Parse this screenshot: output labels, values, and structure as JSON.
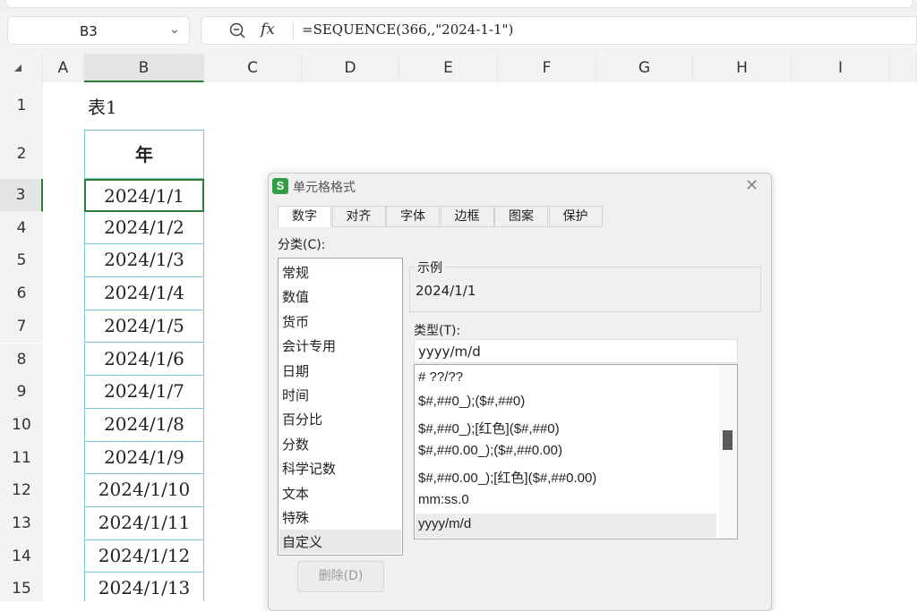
{
  "formula_bar": {
    "name_box": "B3",
    "fx_label": "fx",
    "formula": "=SEQUENCE(366,,\"2024-1-1\")"
  },
  "columns": [
    "A",
    "B",
    "C",
    "D",
    "E",
    "F",
    "G",
    "H",
    "I"
  ],
  "selected_column": "B",
  "rows": [
    "1",
    "2",
    "3",
    "4",
    "5",
    "6",
    "7",
    "8",
    "9",
    "10",
    "11",
    "12",
    "13",
    "14",
    "15"
  ],
  "selected_row": "3",
  "sheet": {
    "title": "表1",
    "header": "年",
    "dates": [
      "2024/1/1",
      "2024/1/2",
      "2024/1/3",
      "2024/1/4",
      "2024/1/5",
      "2024/1/6",
      "2024/1/7",
      "2024/1/8",
      "2024/1/9",
      "2024/1/10",
      "2024/1/11",
      "2024/1/12",
      "2024/1/13"
    ]
  },
  "dialog": {
    "app_icon": "S",
    "title": "单元格格式",
    "tabs": [
      "数字",
      "对齐",
      "字体",
      "边框",
      "图案",
      "保护"
    ],
    "active_tab": "数字",
    "category_label": "分类(C):",
    "categories": [
      "常规",
      "数值",
      "货币",
      "会计专用",
      "日期",
      "时间",
      "百分比",
      "分数",
      "科学记数",
      "文本",
      "特殊",
      "自定义"
    ],
    "selected_category": "自定义",
    "sample_label": "示例",
    "sample_value": "2024/1/1",
    "type_label": "类型(T):",
    "type_value": "yyyy/m/d",
    "formats": [
      "# ??/??",
      "$#,##0_);($#,##0)",
      "$#,##0_);[红色]($#,##0)",
      "$#,##0.00_);($#,##0.00)",
      "$#,##0.00_);[红色]($#,##0.00)",
      "mm:ss.0",
      "yyyy/m/d"
    ],
    "selected_format": "yyyy/m/d",
    "delete_button": "删除(D)"
  }
}
